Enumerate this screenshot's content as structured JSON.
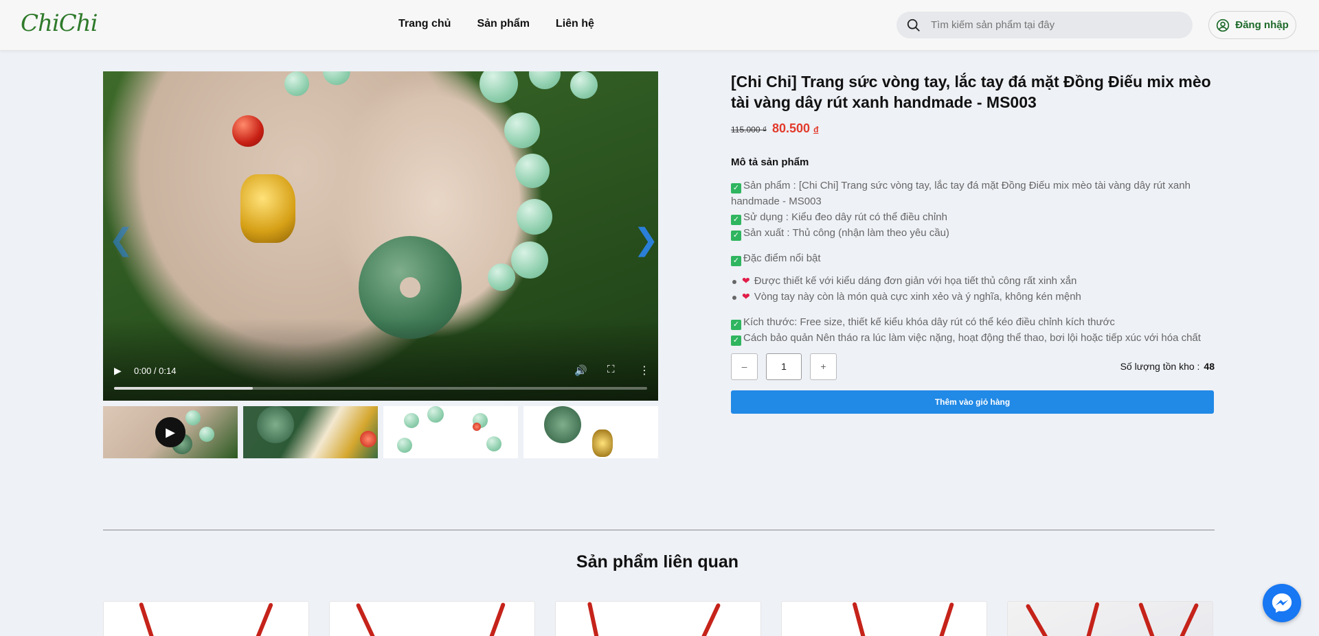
{
  "header": {
    "logo_text": "ChiChi",
    "nav": [
      {
        "label": "Trang chủ"
      },
      {
        "label": "Sản phẩm"
      },
      {
        "label": "Liên hệ"
      }
    ],
    "search_placeholder": "Tìm kiếm sản phẩm tại đây",
    "login_label": "Đăng nhập"
  },
  "video": {
    "time": "0:00 / 0:14",
    "progress": 0.26
  },
  "product": {
    "title": "[Chi Chi] Trang sức vòng tay, lắc tay đá mặt Đồng Điếu mix mèo tài vàng dây rút xanh handmade - MS003",
    "old_price": "115.000 ₫",
    "new_price": "80.500",
    "currency": "đ",
    "desc_heading": "Mô tả sản phẩm",
    "desc_lines": [
      "Sản phẩm : [Chi Chi] Trang sức vòng tay, lắc tay đá mặt Đồng Điếu mix mèo tài vàng dây rút xanh handmade - MS003",
      "Sử dụng : Kiểu đeo dây rút có thể điều chỉnh",
      "Sản xuất : Thủ công (nhận làm theo yêu cầu)"
    ],
    "highlight_heading": "Đặc điểm nổi bật",
    "highlights": [
      "Được thiết kế với kiểu dáng đơn giản với họa tiết thủ công rất xinh xắn",
      "Vòng tay này còn là món quà cực xinh xẻo và ý nghĩa, không kén mệnh"
    ],
    "size_line": "Kích thước: Free size, thiết kế kiểu khóa dây rút có thể kéo điều chỉnh kích thước",
    "care_line": "Cách bảo quản Nên tháo ra lúc làm việc nặng, hoạt động thể thao, bơi lội hoặc tiếp xúc với hóa chất",
    "quantity": "1",
    "minus_label": "–",
    "plus_label": "+",
    "stock_label": "Số lượng tồn kho :",
    "stock_value": "48",
    "add_to_cart_label": "Thêm vào giỏ hàng"
  },
  "related": {
    "title": "Sản phẩm liên quan"
  },
  "colors": {
    "brand_green": "#2f7a2b",
    "price_red": "#e23a2c",
    "cart_blue": "#2189e6",
    "messenger_blue": "#1877f2"
  }
}
